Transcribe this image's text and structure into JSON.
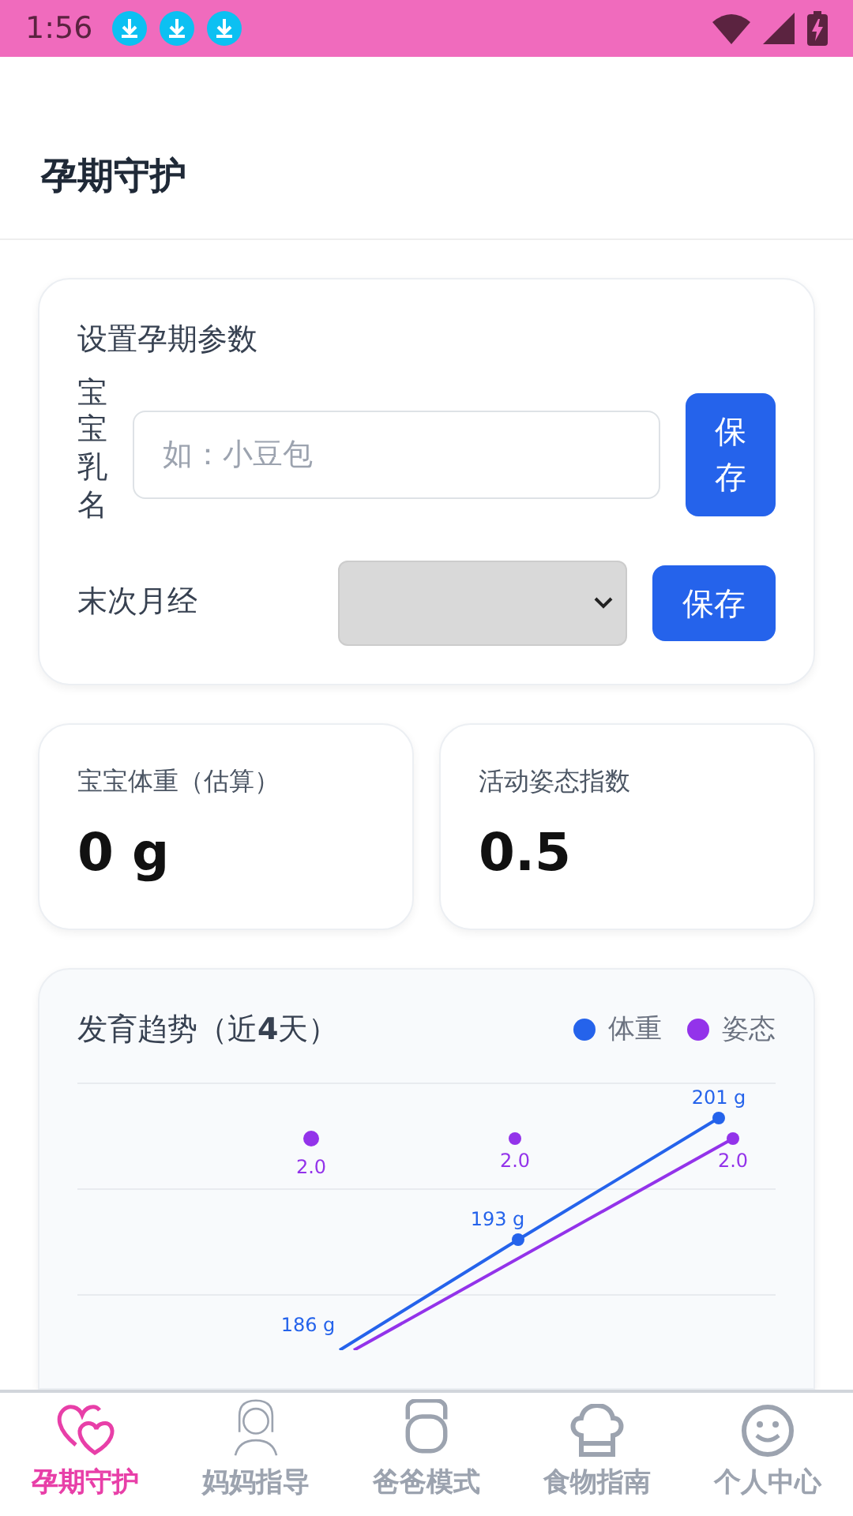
{
  "status_bar": {
    "time": "1:56",
    "notifications": [
      {
        "kind": "download"
      },
      {
        "kind": "download"
      },
      {
        "kind": "download"
      }
    ]
  },
  "header": {
    "title": "孕期守护"
  },
  "settings": {
    "title": "设置孕期参数",
    "name_row": {
      "label": "宝宝乳名",
      "placeholder": "如：小豆包",
      "button": "保存"
    },
    "date_row": {
      "label": "末次月经",
      "button": "保存"
    }
  },
  "stats": [
    {
      "label": "宝宝体重（估算）",
      "value": "0 g"
    },
    {
      "label": "活动姿态指数",
      "value": "0.5"
    }
  ],
  "trend": {
    "title": "发育趋势（近**4**天）",
    "legend": [
      {
        "label": "体重",
        "color": "#2563eb"
      },
      {
        "label": "姿态",
        "color": "#9333ea"
      }
    ],
    "point_labels": [
      {
        "text": "201 g",
        "color": "#2563eb"
      },
      {
        "text": "2.0",
        "color": "#9333ea"
      },
      {
        "text": "2.0",
        "color": "#9333ea"
      },
      {
        "text": "2.0",
        "color": "#9333ea"
      },
      {
        "text": "193 g",
        "color": "#2563eb"
      },
      {
        "text": "186 g",
        "color": "#2563eb"
      }
    ]
  },
  "tabs": [
    {
      "label": "孕期守护",
      "selected": true
    },
    {
      "label": "妈妈指导",
      "selected": false
    },
    {
      "label": "爸爸模式",
      "selected": false
    },
    {
      "label": "食物指南",
      "selected": false
    },
    {
      "label": "个人中心",
      "selected": false
    }
  ]
}
